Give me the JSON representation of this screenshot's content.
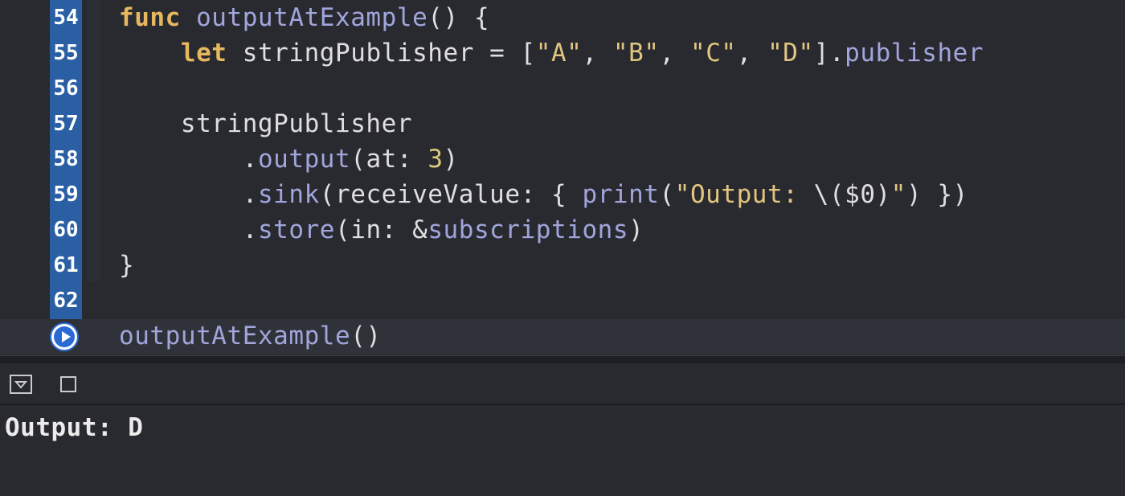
{
  "editor": {
    "lines": [
      {
        "num": "54",
        "parts": [
          {
            "t": "func",
            "c": "kwy"
          },
          {
            "t": " "
          },
          {
            "t": "outputAtExample",
            "c": "fn"
          },
          {
            "t": "() {"
          }
        ]
      },
      {
        "num": "55",
        "parts": [
          {
            "t": "    "
          },
          {
            "t": "let",
            "c": "kwy"
          },
          {
            "t": " stringPublisher = ["
          },
          {
            "t": "\"A\"",
            "c": "str"
          },
          {
            "t": ", "
          },
          {
            "t": "\"B\"",
            "c": "str"
          },
          {
            "t": ", "
          },
          {
            "t": "\"C\"",
            "c": "str"
          },
          {
            "t": ", "
          },
          {
            "t": "\"D\"",
            "c": "str"
          },
          {
            "t": "]."
          },
          {
            "t": "publisher",
            "c": "fn"
          }
        ]
      },
      {
        "num": "56",
        "parts": []
      },
      {
        "num": "57",
        "parts": [
          {
            "t": "    stringPublisher"
          }
        ]
      },
      {
        "num": "58",
        "parts": [
          {
            "t": "        ."
          },
          {
            "t": "output",
            "c": "fn"
          },
          {
            "t": "(at: "
          },
          {
            "t": "3",
            "c": "num"
          },
          {
            "t": ")"
          }
        ]
      },
      {
        "num": "59",
        "parts": [
          {
            "t": "        ."
          },
          {
            "t": "sink",
            "c": "fn"
          },
          {
            "t": "(receiveValue: { "
          },
          {
            "t": "print",
            "c": "fn"
          },
          {
            "t": "("
          },
          {
            "t": "\"Output: ",
            "c": "str"
          },
          {
            "t": "\\($0)"
          },
          {
            "t": "\"",
            "c": "str"
          },
          {
            "t": ") })"
          }
        ]
      },
      {
        "num": "60",
        "parts": [
          {
            "t": "        ."
          },
          {
            "t": "store",
            "c": "fn"
          },
          {
            "t": "(in: &"
          },
          {
            "t": "subscriptions",
            "c": "fn"
          },
          {
            "t": ")"
          }
        ]
      },
      {
        "num": "61",
        "parts": [
          {
            "t": "}"
          }
        ]
      },
      {
        "num": "62",
        "parts": []
      },
      {
        "num": "",
        "parts": [
          {
            "t": "outputAtExample",
            "c": "fn"
          },
          {
            "t": "()"
          }
        ]
      }
    ]
  },
  "run_button": {
    "icon": "play-icon",
    "accent": "#2a6ad5"
  },
  "console": {
    "toggle_icon": "hide-console-icon",
    "clear_icon": "clear-console-icon",
    "output": "Output: D"
  },
  "colors": {
    "background": "#292a30",
    "gutter_highlight": "#2a5fa4",
    "keyword": "#e5b85f",
    "function": "#a0a5db",
    "string": "#e2c680"
  }
}
